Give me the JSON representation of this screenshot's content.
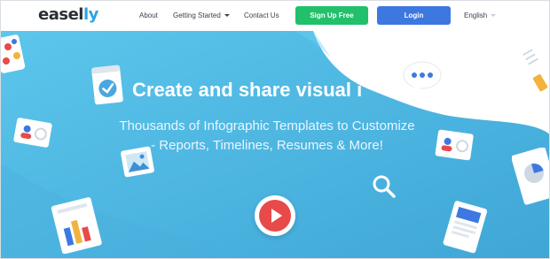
{
  "nav": {
    "logo_part1": "easel",
    "logo_part2": "ly",
    "about": "About",
    "getting_started": "Getting Started",
    "contact": "Contact Us",
    "signup": "Sign Up Free",
    "login": "Login",
    "language": "English"
  },
  "hero": {
    "headline": "Create and share visual i",
    "subline": "Thousands of Infographic Templates to Customize - Reports, Timelines, Resumes & More!"
  },
  "colors": {
    "hero_blue": "#55bde4",
    "signup_green": "#21c06b",
    "login_blue": "#3d78e0",
    "play_red": "#e84a4a"
  },
  "icons": [
    "palette-icon",
    "check-card-icon",
    "profile-card-icon",
    "image-icon",
    "chart-doc-icon",
    "chat-bubble-icon",
    "search-icon",
    "play-icon",
    "document-icon",
    "pie-doc-icon",
    "pencil-icon"
  ]
}
